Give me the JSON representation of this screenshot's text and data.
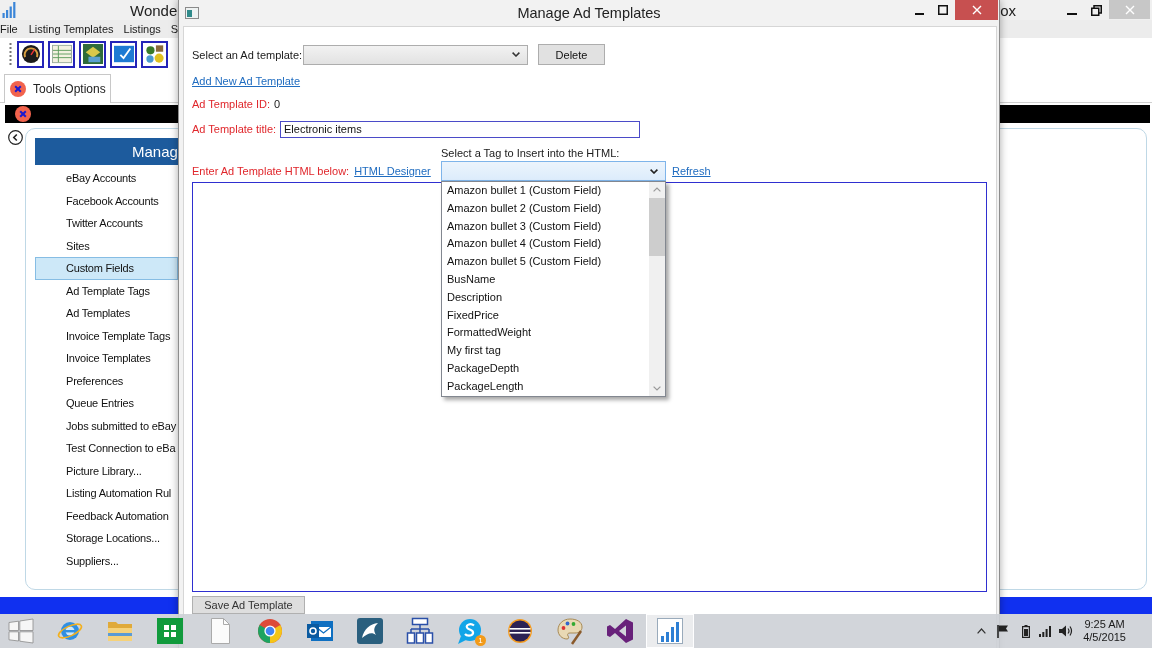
{
  "main_window": {
    "title_parts": [
      "Wonde",
      "ox"
    ],
    "menu": [
      "File",
      "Listing Templates",
      "Listings",
      "S"
    ],
    "tabs": [
      {
        "label": "Tools Options",
        "selected": true
      }
    ],
    "sidebar": {
      "header": "Manag",
      "items": [
        {
          "label": "eBay Accounts",
          "selected": false
        },
        {
          "label": "Facebook Accounts",
          "selected": false
        },
        {
          "label": "Twitter Accounts",
          "selected": false
        },
        {
          "label": "Sites",
          "selected": false
        },
        {
          "label": "Custom Fields",
          "selected": true
        },
        {
          "label": "Ad Template Tags",
          "selected": false
        },
        {
          "label": "Ad Templates",
          "selected": false
        },
        {
          "label": "Invoice Template Tags",
          "selected": false
        },
        {
          "label": "Invoice Templates",
          "selected": false
        },
        {
          "label": "Preferences",
          "selected": false
        },
        {
          "label": "Queue Entries",
          "selected": false
        },
        {
          "label": "Jobs submitted to eBay",
          "selected": false
        },
        {
          "label": "Test Connection to eBa",
          "selected": false
        },
        {
          "label": "Picture Library...",
          "selected": false
        },
        {
          "label": "Listing Automation Rul",
          "selected": false
        },
        {
          "label": "Feedback Automation",
          "selected": false
        },
        {
          "label": "Storage Locations...",
          "selected": false
        },
        {
          "label": "Suppliers...",
          "selected": false
        }
      ]
    }
  },
  "dialog": {
    "title": "Manage Ad Templates",
    "template_select": {
      "label": "Select an Ad template:"
    },
    "delete_button": "Delete",
    "add_link": "Add New Ad Template",
    "id_field": {
      "label": "Ad Template ID:",
      "value": "0"
    },
    "title_field": {
      "label": "Ad Template title:",
      "value": "Electronic items"
    },
    "tag_select": {
      "label": "Select a Tag to Insert into the HTML:",
      "expanded": true,
      "options": [
        {
          "label": "Amazon bullet 1 (Custom Field)",
          "selected": false
        },
        {
          "label": "Amazon bullet 2 (Custom Field)",
          "selected": false
        },
        {
          "label": "Amazon bullet 3 (Custom Field)",
          "selected": false
        },
        {
          "label": "Amazon bullet 4 (Custom Field)",
          "selected": false
        },
        {
          "label": "Amazon bullet 5 (Custom Field)",
          "selected": false
        },
        {
          "label": "BusName",
          "selected": false
        },
        {
          "label": "Description",
          "selected": false
        },
        {
          "label": "FixedPrice",
          "selected": false
        },
        {
          "label": "FormattedWeight",
          "selected": false
        },
        {
          "label": "My first tag",
          "selected": false
        },
        {
          "label": "PackageDepth",
          "selected": false
        },
        {
          "label": "PackageLength",
          "selected": false
        }
      ]
    },
    "html_label": "Enter Ad Template HTML below:",
    "designer_link": "HTML Designer",
    "refresh_link": "Refresh",
    "save_button": "Save Ad Template"
  },
  "taskbar": {
    "apps": [
      {
        "kind": "globe",
        "active": false
      },
      {
        "kind": "folder",
        "active": false
      },
      {
        "kind": "store",
        "active": false
      },
      {
        "kind": "document",
        "active": false
      },
      {
        "kind": "ring",
        "active": false
      },
      {
        "kind": "mail",
        "active": false
      },
      {
        "kind": "swoosh",
        "active": false
      },
      {
        "kind": "hierarchy",
        "active": false
      },
      {
        "kind": "chat",
        "active": false,
        "badge": "1"
      },
      {
        "kind": "stripes",
        "active": false
      },
      {
        "kind": "palette",
        "active": false
      },
      {
        "kind": "loop",
        "active": false
      },
      {
        "kind": "chart",
        "active": true
      }
    ],
    "clock": {
      "time": "9:25 AM",
      "date": "4/5/2015"
    }
  }
}
